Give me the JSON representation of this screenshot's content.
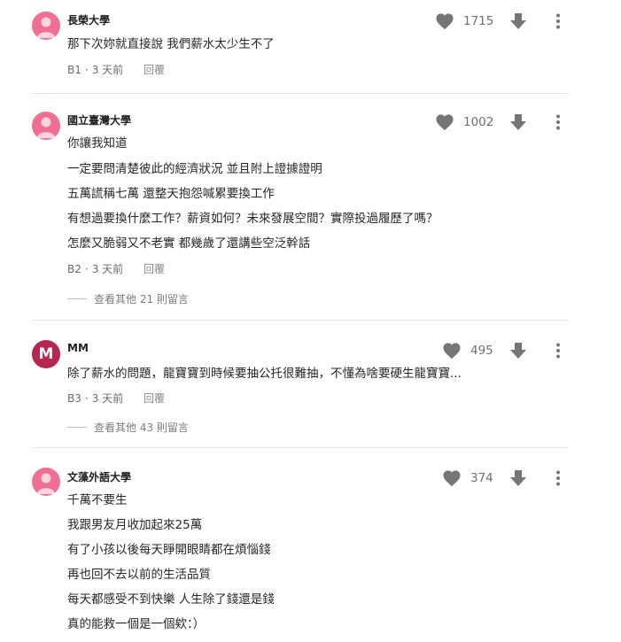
{
  "comments": [
    {
      "author": "長榮大學",
      "avatar": "pink-person-icon",
      "likes": "1715",
      "lines": [
        "那下次妳就直接說 我們薪水太少生不了"
      ],
      "floor": "B1",
      "time": "3 天前",
      "reply_label": "回覆"
    },
    {
      "author": "國立臺灣大學",
      "avatar": "pink-person-icon",
      "likes": "1002",
      "lines": [
        "你讓我知道",
        "一定要問清楚彼此的經濟狀況 並且附上證據證明",
        "五萬謊稱七萬 還整天抱怨喊累要換工作",
        "有想過要換什麼工作？薪資如何？未來發展空間？實際投過履歷了嗎？",
        "怎麼又脆弱又不老實 都幾歲了還講些空泛幹話"
      ],
      "floor": "B2",
      "time": "3 天前",
      "reply_label": "回覆",
      "more_replies": "查看其他 21 則留言"
    },
    {
      "author": "MM",
      "avatar_letter": "M",
      "avatar_color": "#b5274f",
      "likes": "495",
      "lines": [
        "除了薪水的問題，龍寶寶到時候要抽公托很難抽，不懂為啥要硬生龍寶寶..."
      ],
      "floor": "B3",
      "time": "3 天前",
      "reply_label": "回覆",
      "more_replies": "查看其他 43 則留言"
    },
    {
      "author": "文藻外語大學",
      "avatar": "pink-person-icon",
      "likes": "374",
      "lines": [
        "千萬不要生",
        "我跟男友月收加起來25萬",
        "有了小孩以後每天睜開眼睛都在煩惱錢",
        "再也回不去以前的生活品質",
        "每天都感受不到快樂 人生除了錢還是錢",
        "真的能救一個是一個欸：）"
      ]
    }
  ],
  "meta_separator": "·",
  "colors": {
    "avatar_pink": "#f06e93",
    "icon_gray": "#6f6f6f"
  }
}
